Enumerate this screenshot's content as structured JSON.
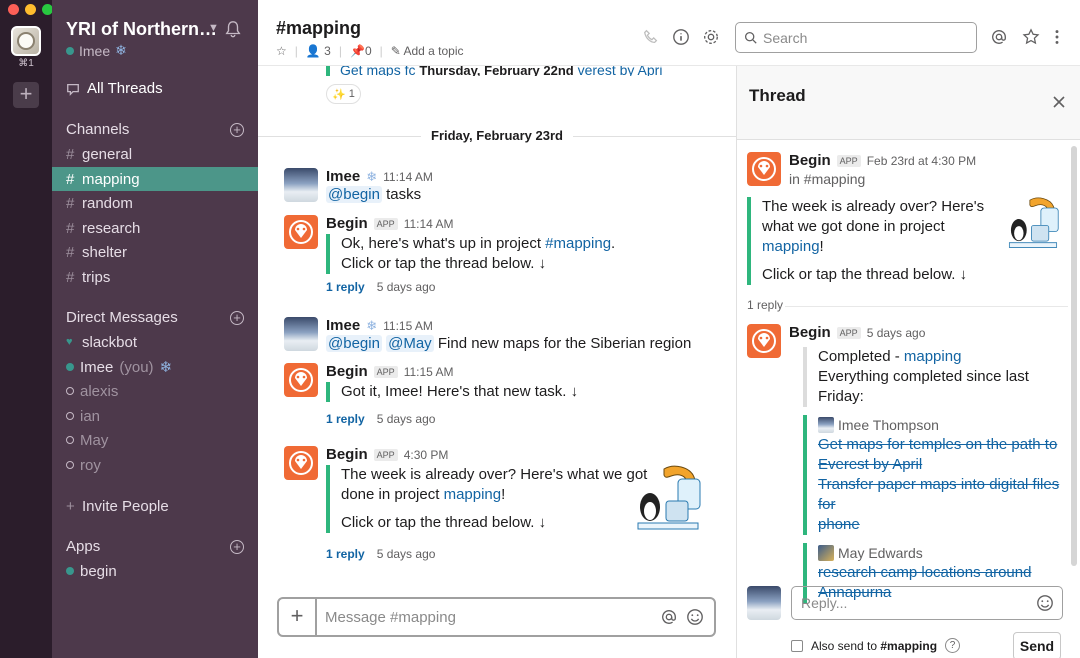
{
  "rail": {
    "shortcut": "⌘1",
    "add": "+"
  },
  "workspace": {
    "name": "YRI of Northern…",
    "user": "Imee",
    "user_emoji": "❄"
  },
  "sidebar": {
    "all_threads": "All Threads",
    "channels_label": "Channels",
    "channels": [
      "general",
      "mapping",
      "random",
      "research",
      "shelter",
      "trips"
    ],
    "dm_label": "Direct Messages",
    "dms": [
      {
        "name": "slackbot",
        "status": "heart"
      },
      {
        "name": "Imee",
        "suffix": "(you)",
        "status": "online"
      },
      {
        "name": "alexis",
        "status": "away"
      },
      {
        "name": "ian",
        "status": "away"
      },
      {
        "name": "May",
        "status": "away"
      },
      {
        "name": "roy",
        "status": "away"
      }
    ],
    "invite": "Invite People",
    "apps_label": "Apps",
    "apps": [
      "begin"
    ]
  },
  "header": {
    "channel": "#mapping",
    "members": "3",
    "pins": "0",
    "topic": "Add a topic",
    "search_placeholder": "Search"
  },
  "messages": {
    "top_partial": {
      "left": "Get maps fc",
      "date": "Thursday, February 22nd",
      "right": "verest by Apri",
      "reaction_count": "1"
    },
    "date_divider": "Friday, February 23rd",
    "m1": {
      "author": "Imee",
      "time": "11:14 AM",
      "mention": "@begin",
      "text": " tasks"
    },
    "m2": {
      "author": "Begin",
      "badge": "APP",
      "time": "11:14 AM",
      "line1a": "Ok, here's what's up in project ",
      "line1link": "#mapping",
      "line1b": ".",
      "line2": "Click or tap the thread below. ↓",
      "reply": "1 reply",
      "ago": "5 days ago"
    },
    "m3": {
      "author": "Imee",
      "time": "11:15 AM",
      "mention1": "@begin",
      "mention2": "@May",
      "text": " Find new maps for the Siberian region"
    },
    "m4": {
      "author": "Begin",
      "badge": "APP",
      "time": "11:15 AM",
      "line1": "Got it, Imee! Here's that new task. ↓",
      "reply": "1 reply",
      "ago": "5 days ago"
    },
    "m5": {
      "author": "Begin",
      "badge": "APP",
      "time": "4:30 PM",
      "line1": "The week is already over? Here's what we got",
      "line2a": "done in project ",
      "line2link": "mapping",
      "line2b": "!",
      "line3": "Click or tap the thread below. ↓",
      "reply": "1 reply",
      "ago": "5 days ago"
    }
  },
  "composer": {
    "placeholder": "Message #mapping"
  },
  "thread": {
    "title": "Thread",
    "parent": {
      "author": "Begin",
      "badge": "APP",
      "time": "Feb 23rd at 4:30 PM",
      "channel": "in #mapping",
      "line1": "The week is already over? Here's",
      "line2": "what we got done in project",
      "link": "mapping",
      "bang": "!",
      "line3": "Click or tap the thread below. ↓"
    },
    "reply_count": "1 reply",
    "reply": {
      "author": "Begin",
      "badge": "APP",
      "time": "5 days ago",
      "completed_label": "Completed - ",
      "completed_link": "mapping",
      "summary": "Everything completed since last Friday:",
      "person1": "Imee Thompson",
      "task1a": "Get maps for temples on the path to",
      "task1b": "Everest by April",
      "task2a": "Transfer paper maps into digital files for",
      "task2b": "phone",
      "person2": "May Edwards",
      "task3a": "research camp locations around",
      "task3b": "Annapurna"
    },
    "reply_placeholder": "Reply...",
    "also_send": "Also send to ",
    "also_channel": "#mapping",
    "send": "Send"
  }
}
